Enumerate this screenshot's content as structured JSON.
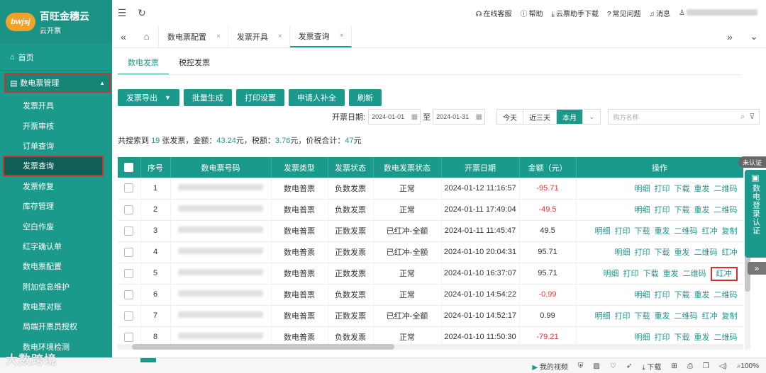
{
  "brand": {
    "logo": "bwjsj",
    "name": "百旺金穗云",
    "sub": "云开票"
  },
  "sidebar": {
    "home": "首页",
    "group": "数电票管理",
    "items": [
      "发票开具",
      "开票审核",
      "订单查询",
      "发票查询",
      "发票修复",
      "库存管理",
      "空白作废",
      "红字确认单",
      "数电票配置",
      "附加信息维护",
      "数电票对账",
      "局端开票员授权",
      "数电环境检测"
    ]
  },
  "topbar": {
    "service": "在线客服",
    "help": "帮助",
    "download": "云票助手下载",
    "faq": "常见问题",
    "messages": "消息"
  },
  "tabstrip": {
    "tabs": [
      "数电票配置",
      "发票开具",
      "发票查询"
    ]
  },
  "subtabs": [
    "数电发票",
    "税控发票"
  ],
  "toolbar": {
    "export": "发票导出",
    "batch": "批量生成",
    "print": "打印设置",
    "applicant": "申请人补全",
    "refresh": "刷新"
  },
  "filter": {
    "label": "开票日期:",
    "from": "2024-01-01",
    "sep": "至",
    "to": "2024-01-31",
    "today": "今天",
    "three_days": "近三天",
    "month": "本月",
    "search_placeholder": "购方名称"
  },
  "summary": {
    "p1": "共搜索到 ",
    "count": "19",
    "p2": " 张发票，金额：",
    "amount": "43.24",
    "p3": "元，税额：",
    "tax": "3.76",
    "p4": "元，价税合计：",
    "total": "47",
    "p5": "元"
  },
  "table": {
    "headers": [
      "序号",
      "数电票号码",
      "发票类型",
      "发票状态",
      "数电发票状态",
      "开票日期",
      "金额（元）",
      "操作"
    ],
    "rows": [
      {
        "no": "1",
        "type": "数电普票",
        "status": "负数发票",
        "dstatus": "正常",
        "date": "2024-01-12 11:16:57",
        "amount": "-95.71",
        "neg": true,
        "ops": [
          "明细",
          "打印",
          "下载",
          "重发",
          "二维码"
        ]
      },
      {
        "no": "2",
        "type": "数电普票",
        "status": "负数发票",
        "dstatus": "正常",
        "date": "2024-01-11 17:49:04",
        "amount": "-49.5",
        "neg": true,
        "ops": [
          "明细",
          "打印",
          "下载",
          "重发",
          "二维码"
        ]
      },
      {
        "no": "3",
        "type": "数电普票",
        "status": "正数发票",
        "dstatus": "已红冲-全额",
        "date": "2024-01-11 11:45:47",
        "amount": "49.5",
        "neg": false,
        "ops": [
          "明细",
          "打印",
          "下载",
          "重发",
          "二维码",
          "红冲",
          "复制"
        ]
      },
      {
        "no": "4",
        "type": "数电普票",
        "status": "正数发票",
        "dstatus": "已红冲-全额",
        "date": "2024-01-10 20:04:31",
        "amount": "95.71",
        "neg": false,
        "ops": [
          "明细",
          "打印",
          "下载",
          "重发",
          "二维码",
          "红冲"
        ]
      },
      {
        "no": "5",
        "type": "数电普票",
        "status": "正数发票",
        "dstatus": "正常",
        "date": "2024-01-10 16:37:07",
        "amount": "95.71",
        "neg": false,
        "ops": [
          "明细",
          "打印",
          "下载",
          "重发",
          "二维码",
          "红冲"
        ],
        "highlight": 5
      },
      {
        "no": "6",
        "type": "数电普票",
        "status": "负数发票",
        "dstatus": "正常",
        "date": "2024-01-10 14:54:22",
        "amount": "-0.99",
        "neg": true,
        "ops": [
          "明细",
          "打印",
          "下载",
          "重发",
          "二维码"
        ]
      },
      {
        "no": "7",
        "type": "数电普票",
        "status": "正数发票",
        "dstatus": "已红冲-全额",
        "date": "2024-01-10 14:52:17",
        "amount": "0.99",
        "neg": false,
        "ops": [
          "明细",
          "打印",
          "下载",
          "重发",
          "二维码",
          "红冲",
          "复制"
        ]
      },
      {
        "no": "8",
        "type": "数电普票",
        "status": "负数发票",
        "dstatus": "正常",
        "date": "2024-01-10 11:50:30",
        "amount": "-79.21",
        "neg": true,
        "ops": [
          "明细",
          "打印",
          "下载",
          "重发",
          "二维码"
        ]
      }
    ]
  },
  "float": {
    "badge": "未认证",
    "label": "数电登录认证"
  },
  "bottom": {
    "watermark": "大数跨境",
    "video": "我的视频",
    "download": "下载",
    "zoom": "100%"
  },
  "colors": {
    "accent": "#1b9a8c",
    "negative": "#e53935",
    "highlight": "#d32f2f"
  }
}
